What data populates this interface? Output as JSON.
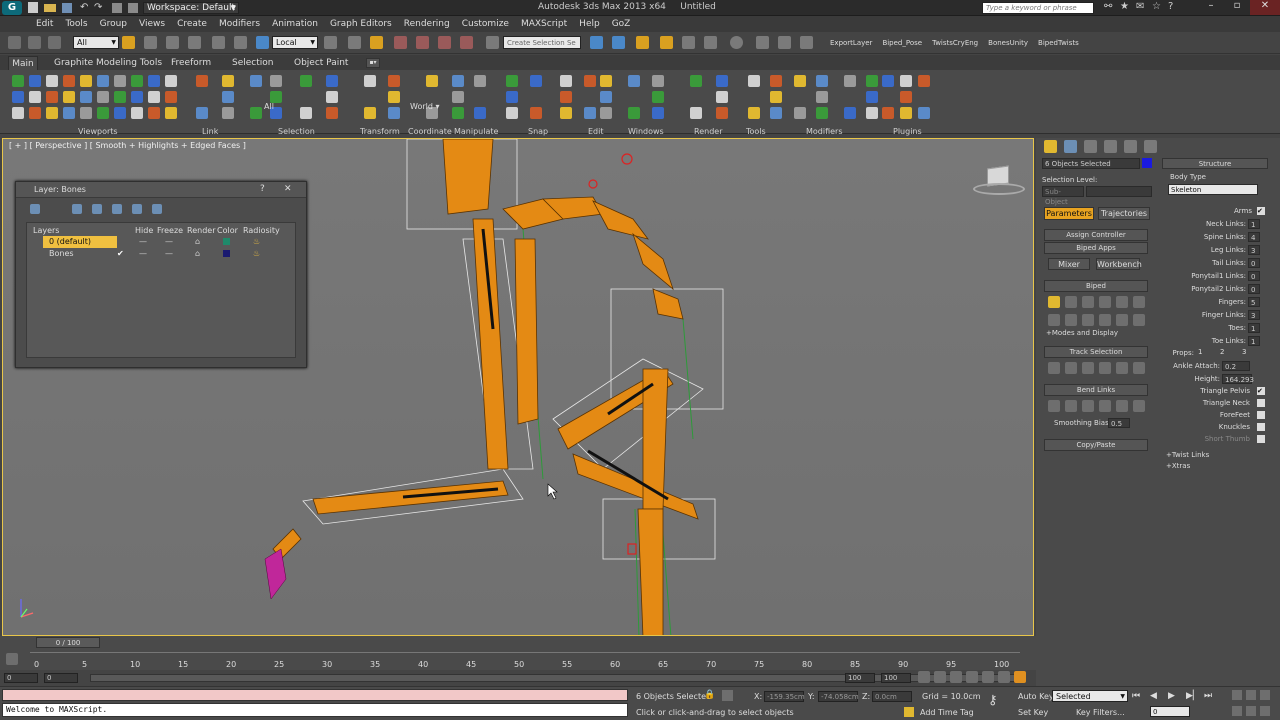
{
  "title": {
    "workspace": "Workspace: Default",
    "app": "Autodesk 3ds Max 2013 x64",
    "doc": "Untitled",
    "search_placeholder": "Type a keyword or phrase"
  },
  "menu": [
    "Edit",
    "Tools",
    "Group",
    "Views",
    "Create",
    "Modifiers",
    "Animation",
    "Graph Editors",
    "Rendering",
    "Customize",
    "MAXScript",
    "Help",
    "GoZ"
  ],
  "toolbar": {
    "filter": "All",
    "coord": "Local",
    "selection_set": "Create Selection Se",
    "scripts": [
      "ExportLayer",
      "Biped_Pose",
      "TwistsCryEng",
      "BonesUnity",
      "BipedTwists"
    ]
  },
  "ribbon": {
    "tabs": [
      "Main",
      "Graphite Modeling Tools",
      "Freeform",
      "Selection",
      "Object Paint"
    ],
    "groups": [
      "Viewports",
      "Link",
      "Selection",
      "Transform",
      "Coordinate",
      "Manipulate",
      "Snap",
      "Edit",
      "Windows",
      "Render",
      "Tools",
      "Modifiers",
      "Plugins"
    ],
    "all_label": "All",
    "world_label": "World"
  },
  "viewport": {
    "label": "[ + ] [ Perspective ] [ Smooth + Highlights + Edged Faces ]"
  },
  "layer_window": {
    "title": "Layer: Bones",
    "columns": [
      "Layers",
      "Hide",
      "Freeze",
      "Render",
      "Color",
      "Radiosity"
    ],
    "rows": [
      {
        "name": "0 (default)",
        "active": false,
        "color": "#1f8a6a"
      },
      {
        "name": "Bones",
        "active": true,
        "color": "#1a1a70"
      }
    ]
  },
  "command_panel": {
    "selection_field": "6 Objects Selected",
    "selection_level": "Selection Level:",
    "sub_object": "Sub-Object",
    "tabs": [
      "Parameters",
      "Trajectories"
    ],
    "sections": [
      "Assign Controller",
      "Biped Apps",
      "Biped",
      "+Modes and Display",
      "Track Selection",
      "Bend Links",
      "Copy/Paste"
    ],
    "buttons": [
      "Mixer",
      "Workbench"
    ],
    "smoothing_label": "Smoothing Bias:",
    "smoothing_value": "0.5",
    "structure": {
      "header": "Structure",
      "body_type_label": "Body Type",
      "body_type": "Skeleton",
      "arms_label": "Arms",
      "params": [
        {
          "label": "Neck Links:",
          "value": "1"
        },
        {
          "label": "Spine Links:",
          "value": "4"
        },
        {
          "label": "Leg Links:",
          "value": "3"
        },
        {
          "label": "Tail Links:",
          "value": "0"
        },
        {
          "label": "Ponytail1 Links:",
          "value": "0"
        },
        {
          "label": "Ponytail2 Links:",
          "value": "0"
        },
        {
          "label": "Fingers:",
          "value": "5"
        },
        {
          "label": "Finger Links:",
          "value": "3"
        },
        {
          "label": "Toes:",
          "value": "1"
        },
        {
          "label": "Toe Links:",
          "value": "1"
        }
      ],
      "props_label": "Props:",
      "props": [
        "1",
        "2",
        "3"
      ],
      "ankle_label": "Ankle Attach:",
      "ankle_value": "0.2",
      "height_label": "Height:",
      "height_value": "164.293",
      "checks": [
        "Triangle Pelvis",
        "Triangle Neck",
        "ForeFeet",
        "Knuckles",
        "Short Thumb"
      ],
      "twist_links": "+Twist Links",
      "xtras": "+Xtras"
    }
  },
  "timeline": {
    "frame": "0 / 100",
    "ticks": [
      "0",
      "5",
      "10",
      "15",
      "20",
      "25",
      "30",
      "35",
      "40",
      "45",
      "50",
      "55",
      "60",
      "65",
      "70",
      "75",
      "80",
      "85",
      "90",
      "95",
      "100"
    ]
  },
  "status": {
    "maxscript": "Welcome to MAXScript.",
    "selected": "6 Objects Selected",
    "hint": "Click or click-and-drag to select objects",
    "x_value": "-159.35cm",
    "y_value": "-74.058cm",
    "z_value": "0.0cm",
    "grid": "Grid = 10.0cm",
    "auto_key": "Auto Key",
    "set_key": "Set Key",
    "key_selected": "Selected",
    "key_filters": "Key Filters...",
    "add_time_tag": "Add Time Tag",
    "frame_field": "0",
    "frame_total_a": "100",
    "frame_total_b": "100",
    "start_field": "0",
    "end_field": "0"
  }
}
